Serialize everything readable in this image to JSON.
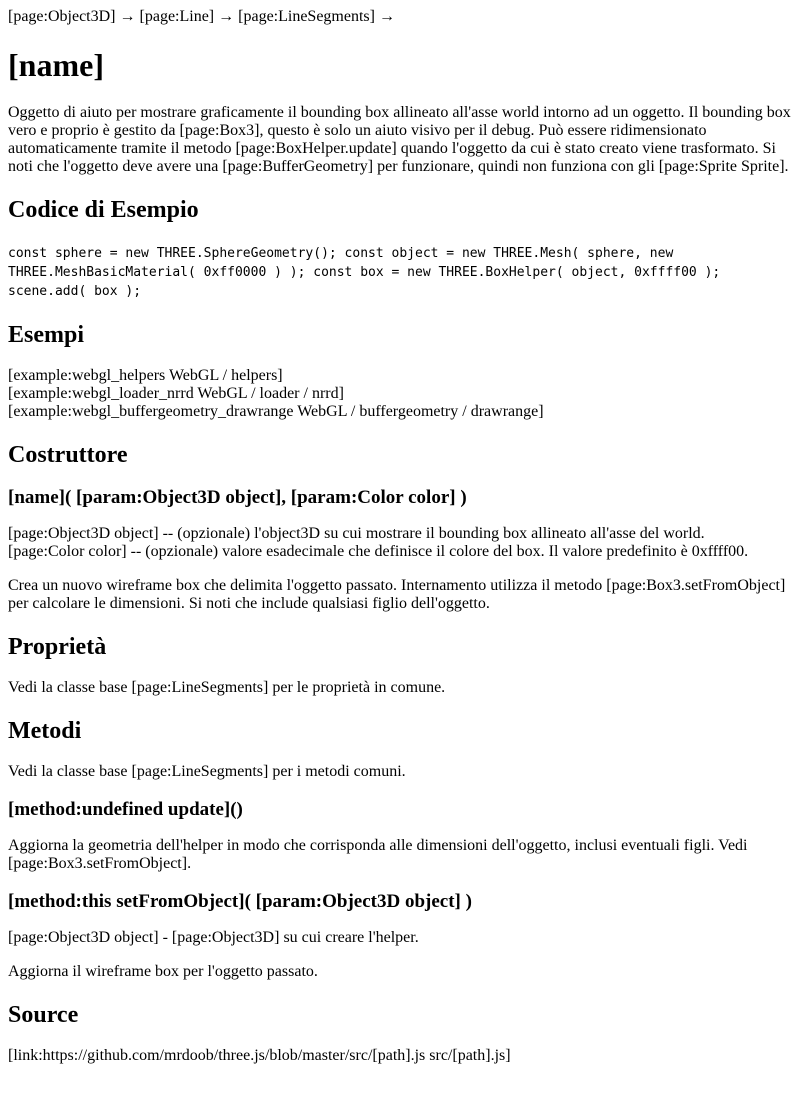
{
  "breadcrumb": "[page:Object3D] → [page:Line] → [page:LineSegments] →",
  "title": "[name]",
  "intro": "Oggetto di aiuto per mostrare graficamente il bounding box allineato all'asse world intorno ad un oggetto. Il bounding box vero e proprio è gestito da [page:Box3], questo è solo un aiuto visivo per il debug. Può essere ridimensionato automaticamente tramite il metodo [page:BoxHelper.update] quando l'oggetto da cui è stato creato viene trasformato. Si noti che l'oggetto deve avere una [page:BufferGeometry] per funzionare, quindi non funziona con gli [page:Sprite Sprite].",
  "example": {
    "heading": "Codice di Esempio",
    "code": "const sphere = new THREE.SphereGeometry(); const object = new THREE.Mesh( sphere, new THREE.MeshBasicMaterial( 0xff0000 ) ); const box = new THREE.BoxHelper( object, 0xffff00 ); scene.add( box );"
  },
  "examples": {
    "heading": "Esempi",
    "items": [
      "[example:webgl_helpers WebGL / helpers]",
      "[example:webgl_loader_nrrd WebGL / loader / nrrd]",
      "[example:webgl_buffergeometry_drawrange WebGL / buffergeometry / drawrange]"
    ]
  },
  "constructor": {
    "heading": "Costruttore",
    "signature": "[name]( [param:Object3D object], [param:Color color] )",
    "params": [
      "[page:Object3D object] -- (opzionale) l'object3D su cui mostrare il bounding box allineato all'asse del world.",
      "[page:Color color] -- (opzionale) valore esadecimale che definisce il colore del box. Il valore predefinito è 0xffff00."
    ],
    "description": "Crea un nuovo wireframe box che delimita l'oggetto passato. Internamento utilizza il metodo [page:Box3.setFromObject] per calcolare le dimensioni. Si noti che include qualsiasi figlio dell'oggetto."
  },
  "properties": {
    "heading": "Proprietà",
    "text": "Vedi la classe base [page:LineSegments] per le proprietà in comune."
  },
  "methods": {
    "heading": "Metodi",
    "text": "Vedi la classe base [page:LineSegments] per i metodi comuni.",
    "update": {
      "signature": "[method:undefined update]()",
      "text": "Aggiorna la geometria dell'helper in modo che corrisponda alle dimensioni dell'oggetto, inclusi eventuali figli. Vedi [page:Box3.setFromObject]."
    },
    "setFromObject": {
      "signature": "[method:this setFromObject]( [param:Object3D object] )",
      "param": "[page:Object3D object] - [page:Object3D] su cui creare l'helper.",
      "text": "Aggiorna il wireframe box per l'oggetto passato."
    }
  },
  "source": {
    "heading": "Source",
    "link": "[link:https://github.com/mrdoob/three.js/blob/master/src/[path].js src/[path].js]"
  }
}
